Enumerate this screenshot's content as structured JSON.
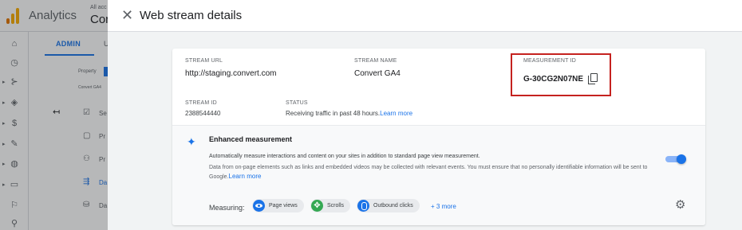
{
  "app": {
    "name": "Analytics",
    "account_crumb": "All acc",
    "account_name": "Cor"
  },
  "admin_nav": {
    "admin_tab": "ADMIN",
    "user_tab": "U",
    "property_label": "Property",
    "property_value": "Convert GA4",
    "menu_items": [
      {
        "icon": "checkbox-icon",
        "label": "Se"
      },
      {
        "icon": "document-icon",
        "label": "Pr"
      },
      {
        "icon": "people-icon",
        "label": "Pr"
      },
      {
        "icon": "data-streams-icon",
        "label": "Da"
      },
      {
        "icon": "database-icon",
        "label": "Da"
      }
    ]
  },
  "dialog": {
    "title": "Web stream details",
    "stream_url_caption": "STREAM URL",
    "stream_url": "http://staging.convert.com",
    "stream_name_caption": "STREAM NAME",
    "stream_name": "Convert GA4",
    "measurement_id_caption": "MEASUREMENT ID",
    "measurement_id": "G-30CG2N07NE",
    "stream_id_caption": "STREAM ID",
    "stream_id": "2388544440",
    "status_caption": "STATUS",
    "status_text": "Receiving traffic in past 48 hours.",
    "status_link": "Learn more"
  },
  "enhanced_measurement": {
    "title": "Enhanced measurement",
    "description": "Automatically measure interactions and content on your sites in addition to standard page view measurement.",
    "note": "Data from on-page elements such as links and embedded videos may be collected with relevant events. You must ensure that no personally identifiable information will be sent to Google.",
    "note_link": "Learn more",
    "enabled": true,
    "measuring_label": "Measuring:",
    "chips": [
      {
        "icon": "eye-icon",
        "label": "Page views"
      },
      {
        "icon": "scroll-icon",
        "label": "Scrolls"
      },
      {
        "icon": "mouse-click-icon",
        "label": "Outbound clicks"
      }
    ],
    "more_label": "+ 3 more"
  },
  "colors": {
    "accent": "#1a73e8",
    "highlight_border": "#c5221f",
    "analytics_orange": "#f9ab00"
  }
}
